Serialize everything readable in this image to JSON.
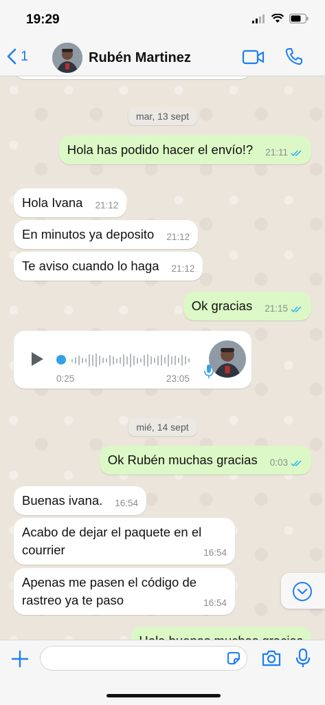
{
  "status": {
    "time": "19:29"
  },
  "header": {
    "back_count": "1",
    "contact_name": "Rubén Martinez"
  },
  "messages": [
    {
      "date": "mar, 13 sept"
    },
    {
      "text": "Hola has podido hacer el envío!?",
      "time": "21:11",
      "dir": "out",
      "read": true
    },
    {
      "text": "Hola Ivana",
      "time": "21:12",
      "dir": "in"
    },
    {
      "text": "En minutos ya deposito",
      "time": "21:12",
      "dir": "in"
    },
    {
      "text": "Te aviso cuando lo haga",
      "time": "21:12",
      "dir": "in"
    },
    {
      "text": "Ok gracias",
      "time": "21:15",
      "dir": "out",
      "read": true
    },
    {
      "voice": {
        "duration": "0:25",
        "time": "23:05"
      }
    },
    {
      "date": "mié, 14 sept"
    },
    {
      "text": "Ok Rubén muchas gracias",
      "time": "0:03",
      "dir": "out",
      "read": true
    },
    {
      "text": "Buenas ivana.",
      "time": "16:54",
      "dir": "in"
    },
    {
      "text": "Acabo de dejar el paquete en el courrier",
      "time": "16:54",
      "dir": "in"
    },
    {
      "text": "Apenas me pasen el código de rastreo ya te paso",
      "time": "16:54",
      "dir": "in"
    },
    {
      "text": "Hola buenas muchas gracias",
      "dir": "out"
    }
  ],
  "colors": {
    "accent": "#1a7ef5",
    "outgoing_bubble": "#dcf8c6",
    "incoming_bubble": "#ffffff",
    "read_check": "#34b7f1"
  },
  "icons": [
    "signal-icon",
    "wifi-icon",
    "battery-icon",
    "chevron-left-icon",
    "video-call-icon",
    "phone-icon",
    "play-icon",
    "microphone-icon",
    "chevron-down-icon",
    "plus-icon",
    "sticker-icon",
    "camera-icon"
  ]
}
